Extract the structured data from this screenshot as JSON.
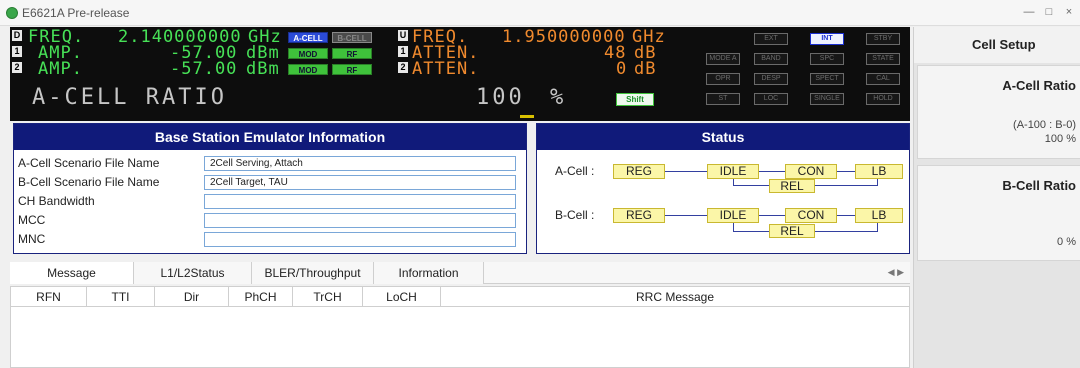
{
  "window": {
    "title": "E6621A Pre-release"
  },
  "display": {
    "ports_left": [
      "D",
      "1",
      "2"
    ],
    "freq_label": "FREQ.",
    "freq_value": "2.140000000",
    "freq_unit": "GHz",
    "amp1_label": "AMP.",
    "amp1_value": "-57.00",
    "amp1_unit": "dBm",
    "amp2_label": "AMP.",
    "amp2_value": "-57.00",
    "amp2_unit": "dBm",
    "ports_right": [
      "U",
      "1",
      "2"
    ],
    "ul_freq_label": "FREQ.",
    "ul_freq_value": "1.950000000",
    "ul_freq_unit": "GHz",
    "atten1_label": "ATTEN.",
    "atten1_value": "48",
    "atten1_unit": "dB",
    "atten2_label": "ATTEN.",
    "atten2_value": "0",
    "atten2_unit": "dB",
    "big_label": "A-CELL RATIO",
    "big_value": "100",
    "big_unit": "%",
    "acell_btn": "A-CELL",
    "bcell_btn": "B-CELL",
    "mod1_btn": "MOD",
    "rf1_btn": "RF",
    "mod2_btn": "MOD",
    "rf2_btn": "RF",
    "shift_btn": "Shift",
    "right_buttons": [
      [
        "EXT",
        "INT",
        "STBY"
      ],
      [
        "MODE A",
        "BAND",
        "SPC",
        "STATE"
      ],
      [
        "OPR",
        "DESP",
        "SPECT",
        "CAL"
      ],
      [
        "ST",
        "LOC",
        "SINGLE",
        "HOLD"
      ]
    ],
    "active_button": "INT",
    "colors": {
      "green": "#47e157",
      "orange": "#f08a2e",
      "accent": "#101a7a"
    }
  },
  "side": {
    "title": "Cell Setup",
    "acell_title": "A-Cell Ratio",
    "acell_formula": "(A-100 : B-0)",
    "acell_value": "100 %",
    "bcell_title": "B-Cell Ratio",
    "bcell_value": "0 %"
  },
  "bse": {
    "title": "Base Station Emulator Information",
    "fields": [
      {
        "label": "A-Cell Scenario File Name",
        "value": "2Cell Serving, Attach"
      },
      {
        "label": "B-Cell Scenario File Name",
        "value": "2Cell Target, TAU"
      },
      {
        "label": "CH Bandwidth",
        "value": ""
      },
      {
        "label": "MCC",
        "value": ""
      },
      {
        "label": "MNC",
        "value": ""
      }
    ]
  },
  "status": {
    "title": "Status",
    "acell_label": "A-Cell :",
    "bcell_label": "B-Cell :",
    "states": {
      "reg": "REG",
      "idle": "IDLE",
      "con": "CON",
      "lb": "LB",
      "rel": "REL"
    }
  },
  "tabs": [
    "Message",
    "L1/L2Status",
    "BLER/Throughput",
    "Information"
  ],
  "message_table": {
    "columns": [
      "RFN",
      "TTI",
      "Dir",
      "PhCH",
      "TrCH",
      "LoCH",
      "RRC Message"
    ]
  }
}
